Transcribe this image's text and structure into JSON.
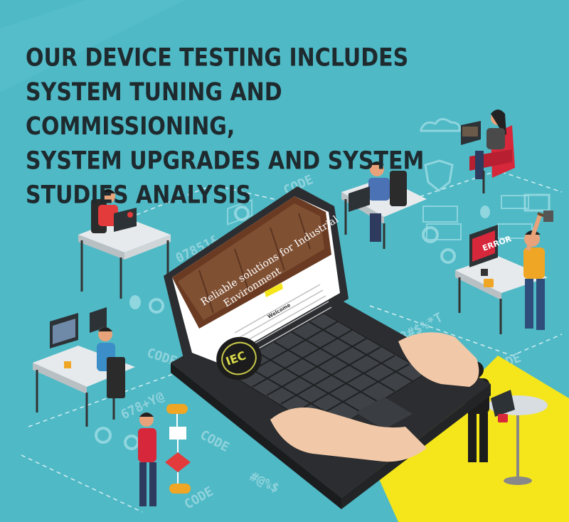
{
  "headline": {
    "line1": "OUR DEVICE TESTING INCLUDES",
    "line2": "SYSTEM TUNING AND COMMISSIONING,",
    "line3": "SYSTEM UPGRADES AND SYSTEM",
    "line4": "STUDIES ANALYSIS"
  },
  "laptop_screen": {
    "hero_line1": "Reliable solutions for Industrial",
    "hero_line2": "Environment",
    "welcome": "Welcome",
    "logo_text": "IEC"
  },
  "floor_labels": {
    "code1": "CODE",
    "code2": "CODE",
    "code3": "CODE",
    "code4": "CODE",
    "code5": "CODE",
    "error_sign": "ERROR",
    "glyphs1": "07851&",
    "glyphs2": "678+Y@",
    "glyphs3": "3#$%*T",
    "glyphs4": "#@%$"
  },
  "colors": {
    "background": "#4fb9c6",
    "headline": "#1e2a2e",
    "accent_yellow": "#f5e61b",
    "floor_glyph": "#8fd3dc"
  }
}
